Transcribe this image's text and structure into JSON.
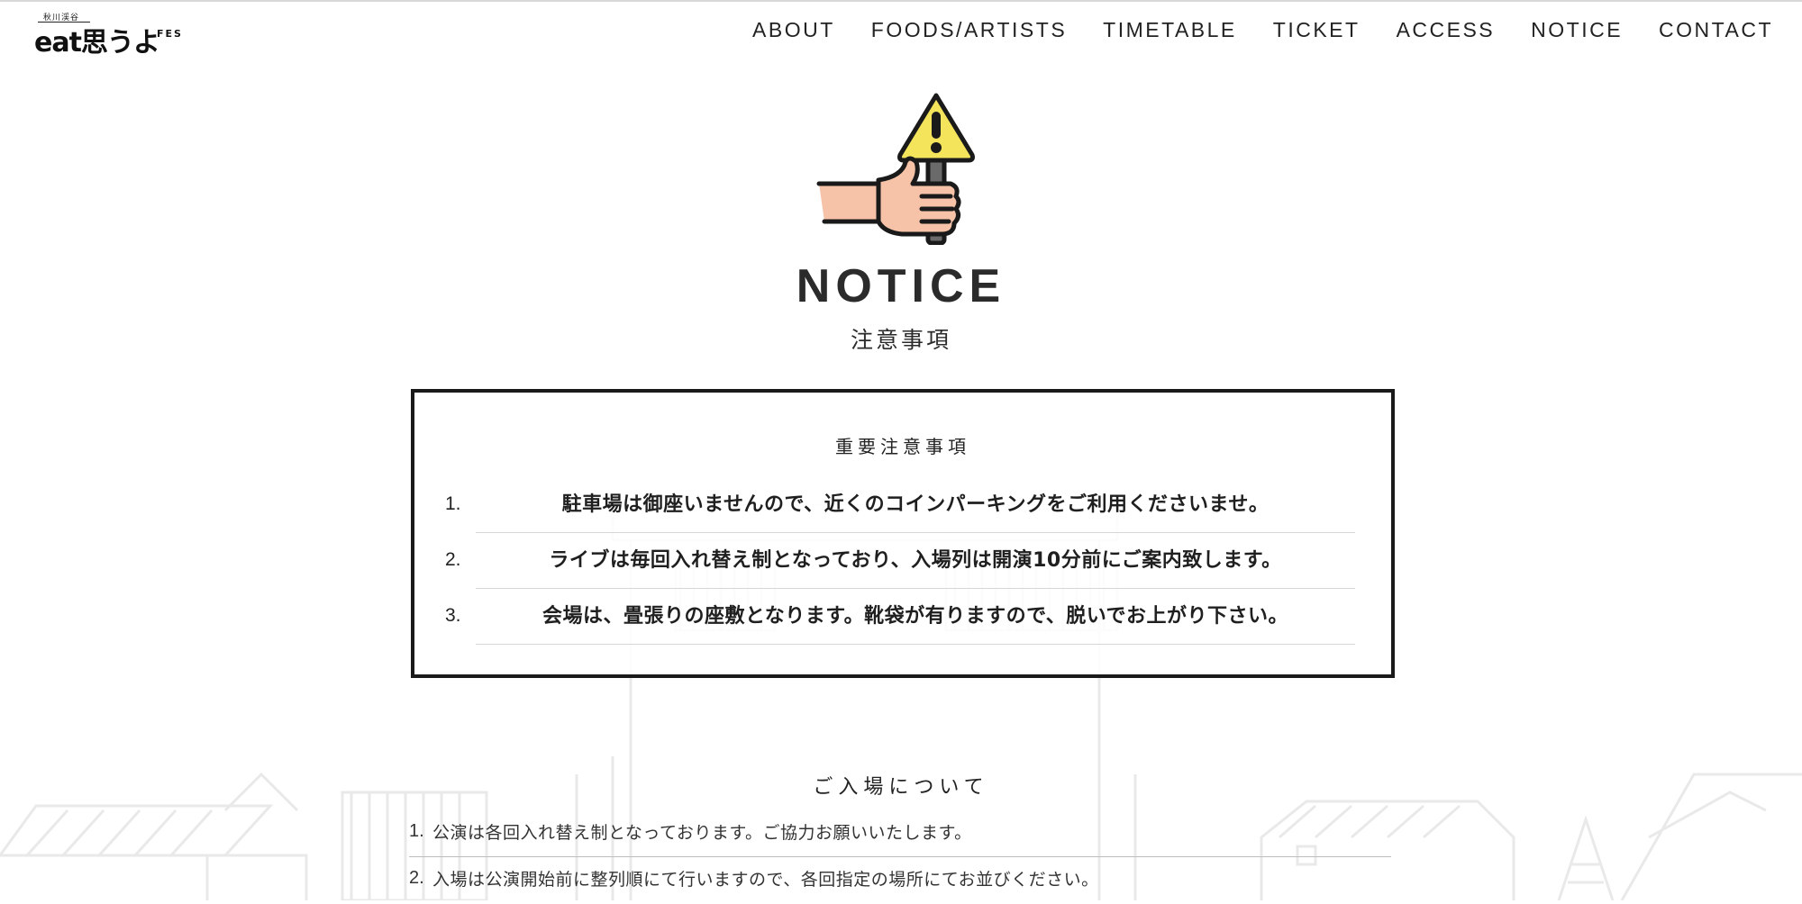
{
  "header": {
    "logo": {
      "sub": "秋川渓谷",
      "main": "eat思うよ",
      "fes": "FES"
    },
    "nav": [
      "ABOUT",
      "FOODS/ARTISTS",
      "TIMETABLE",
      "TICKET",
      "ACCESS",
      "NOTICE",
      "CONTACT"
    ]
  },
  "hero": {
    "icon": "hand-holding-warning-sign-icon",
    "title": "NOTICE",
    "subtitle": "注意事項"
  },
  "important": {
    "title": "重要注意事項",
    "items": [
      {
        "num": "1.",
        "text": "駐車場は御座いませんので、近くのコインパーキングをご利用くださいませ。"
      },
      {
        "num": "2.",
        "text": "ライブは毎回入れ替え制となっており、入場列は開演10分前にご案内致します。"
      },
      {
        "num": "3.",
        "text": "会場は、畳張りの座敷となります。靴袋が有りますので、脱いでお上がり下さい。"
      }
    ]
  },
  "admission": {
    "title": "ご入場について",
    "items": [
      {
        "num": "1.",
        "text": "公演は各回入れ替え制となっております。ご協力お願いいたします。"
      },
      {
        "num": "2.",
        "text": "入場は公演開始前に整列順にて行いますので、各回指定の場所にてお並びください。"
      }
    ]
  },
  "colors": {
    "text": "#1a1a1a",
    "warning_yellow": "#f3e45c",
    "skin": "#f6c3a8",
    "illustration": "#e6e6e6"
  }
}
